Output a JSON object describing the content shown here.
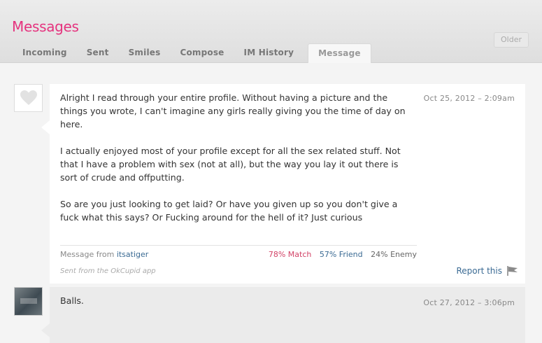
{
  "header": {
    "title": "Messages",
    "tabs": [
      "Incoming",
      "Sent",
      "Smiles",
      "Compose",
      "IM History",
      "Message"
    ],
    "active_tab": "Message",
    "older_label": "Older"
  },
  "messages": [
    {
      "avatar_icon": "heart-icon",
      "date": "Oct 25, 2012 – 2:09am",
      "paragraphs": [
        "Alright I read through your entire profile. Without having a picture and the things you wrote, I can't imagine any girls really giving you the time of day on here.",
        "I actually enjoyed most of your profile except for all the sex related stuff. Not that I have a problem with sex (not at all), but the way you lay it out there is sort of crude and offputting.",
        "So are you just looking to get laid? Or have you given up so you don't give a fuck what this says? Or Fucking around for the hell of it? Just curious"
      ],
      "from_prefix": "Message from",
      "from_user": "itsatiger",
      "match": "78% Match",
      "friend": "57% Friend",
      "enemy": "24% Enemy",
      "app_note": "Sent from the OkCupid app",
      "report_label": "Report this",
      "report_icon": "flag-icon"
    },
    {
      "date": "Oct 27, 2012 – 3:06pm",
      "body": "Balls."
    }
  ],
  "colors": {
    "accent": "#e5337e",
    "link": "#3a6a93",
    "match": "#d24367"
  }
}
